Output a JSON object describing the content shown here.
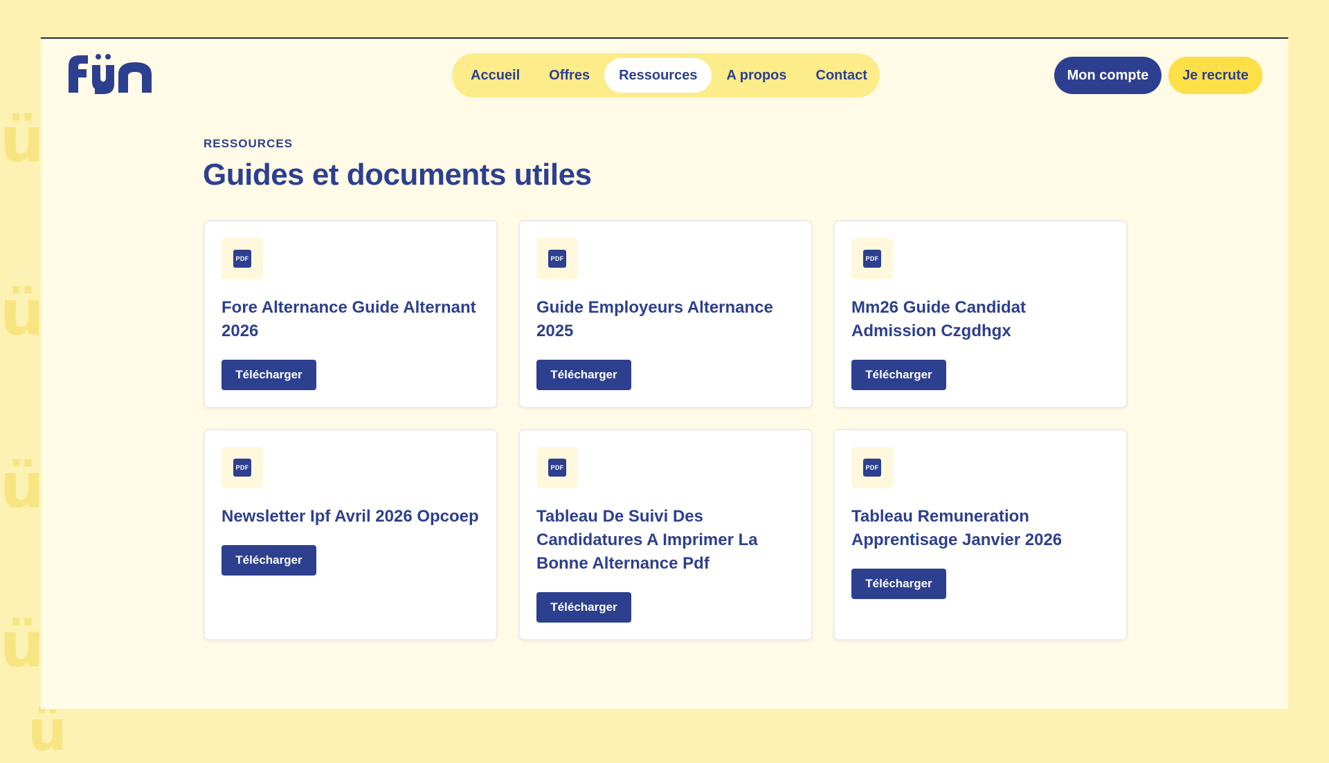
{
  "brand": {
    "logo_text": "fyn",
    "primary": "#2d3f8f",
    "accent": "#fde047",
    "background": "#fdf2b3"
  },
  "nav": {
    "items": [
      {
        "label": "Accueil",
        "active": false
      },
      {
        "label": "Offres",
        "active": false
      },
      {
        "label": "Ressources",
        "active": true
      },
      {
        "label": "A propos",
        "active": false
      },
      {
        "label": "Contact",
        "active": false
      }
    ]
  },
  "header": {
    "account_label": "Mon compte",
    "recruit_label": "Je recrute"
  },
  "main": {
    "eyebrow": "RESSOURCES",
    "title": "Guides et documents utiles",
    "cards": [
      {
        "icon": "pdf-icon",
        "icon_text": "PDF",
        "title": "Fore Alternance Guide Alternant 2026",
        "button": "Télécharger"
      },
      {
        "icon": "pdf-icon",
        "icon_text": "PDF",
        "title": "Guide Employeurs Alternance 2025",
        "button": "Télécharger"
      },
      {
        "icon": "pdf-icon",
        "icon_text": "PDF",
        "title": "Mm26 Guide Candidat Admission Czgdhgx",
        "button": "Télécharger"
      },
      {
        "icon": "pdf-icon",
        "icon_text": "PDF",
        "title": "Newsletter Ipf Avril 2026 Opcoep",
        "button": "Télécharger"
      },
      {
        "icon": "pdf-icon",
        "icon_text": "PDF",
        "title": "Tableau De Suivi Des Candidatures A Imprimer La Bonne Alternance Pdf",
        "button": "Télécharger"
      },
      {
        "icon": "pdf-icon",
        "icon_text": "PDF",
        "title": "Tableau Remuneration Apprentisage Janvier 2026",
        "button": "Télécharger"
      }
    ]
  }
}
